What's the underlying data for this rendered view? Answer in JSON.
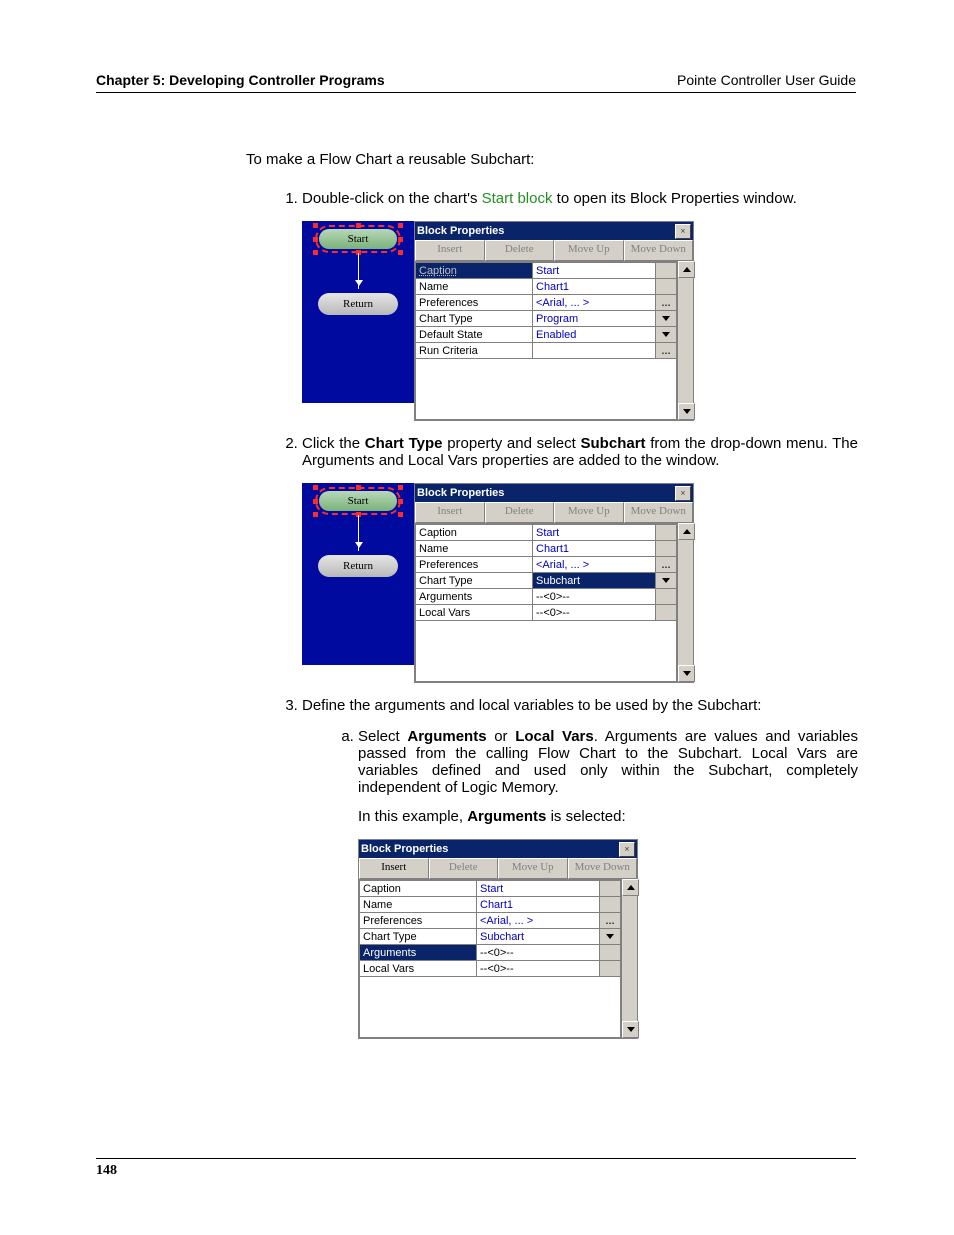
{
  "header": {
    "left": "Chapter 5: Developing Controller Programs",
    "right": "Pointe Controller User Guide"
  },
  "intro": "To make a Flow Chart a reusable Subchart:",
  "step1": {
    "pre": "Double-click on the chart's ",
    "link": "Start block",
    "post": " to open its Block Properties window."
  },
  "step2": {
    "t1": "Click the ",
    "b1": "Chart Type",
    "t2": " property and select ",
    "b2": "Subchart",
    "t3": " from the drop-down menu. The Arguments and Local Vars properties are added to the window."
  },
  "step3": "Define the arguments and local variables to be used by the Subchart:",
  "step3a": {
    "t1": "Select ",
    "b1": "Arguments",
    "t2": " or ",
    "b2": "Local Vars",
    "t3": ". Arguments are values and variables passed from the calling Flow Chart to the Subchart. Local Vars are variables defined and used only within the Subchart, completely independent of Logic Memory."
  },
  "step3a_lead": {
    "t1": "In this example, ",
    "b": "Arguments",
    "t2": " is selected:"
  },
  "flow": {
    "start": "Start",
    "return": "Return"
  },
  "panel": {
    "title": "Block Properties",
    "btn_insert": "Insert",
    "btn_delete": "Delete",
    "btn_moveup": "Move Up",
    "btn_movedown": "Move Down",
    "k_caption": "Caption",
    "k_name": "Name",
    "k_prefs": "Preferences",
    "k_ctype": "Chart Type",
    "k_dstate": "Default State",
    "k_runcrit": "Run Criteria",
    "k_args": "Arguments",
    "k_local": "Local Vars",
    "v_start": "Start",
    "v_name": "Chart1",
    "v_prefs": "<Arial, ... >",
    "v_prog": "Program",
    "v_enabled": "Enabled",
    "v_sub": "Subchart",
    "v_zero": "--<0>--"
  },
  "pagenum": "148"
}
